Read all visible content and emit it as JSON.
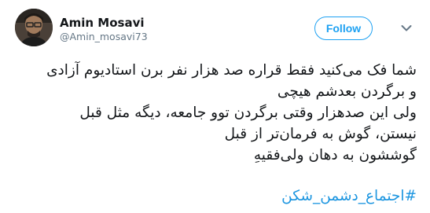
{
  "tweet": {
    "author": {
      "display_name": "Amin Mosavi",
      "handle": "@Amin_mosavi73",
      "avatar_icon": "profile-photo"
    },
    "follow_label": "Follow",
    "menu_icon": "chevron-down-icon",
    "lines": [
      "شما فک می‌کنید فقط قراره صد هزار نفر برن استادیوم آزادی",
      "و برگردن بعدشم هیچی",
      "ولی این صدهزار وقتی برگردن توو جامعه، دیگه مثل قبل",
      "نیستن، گوش به فرمان‌تر از قبل",
      "گوششون به دهان ولی‌فقیهِ"
    ],
    "hashtag": "#اجتماع_دشمن_شکن"
  },
  "colors": {
    "accent": "#1da1f2",
    "link": "#1b95e0",
    "secondary_text": "#657786",
    "primary_text": "#14171a"
  }
}
